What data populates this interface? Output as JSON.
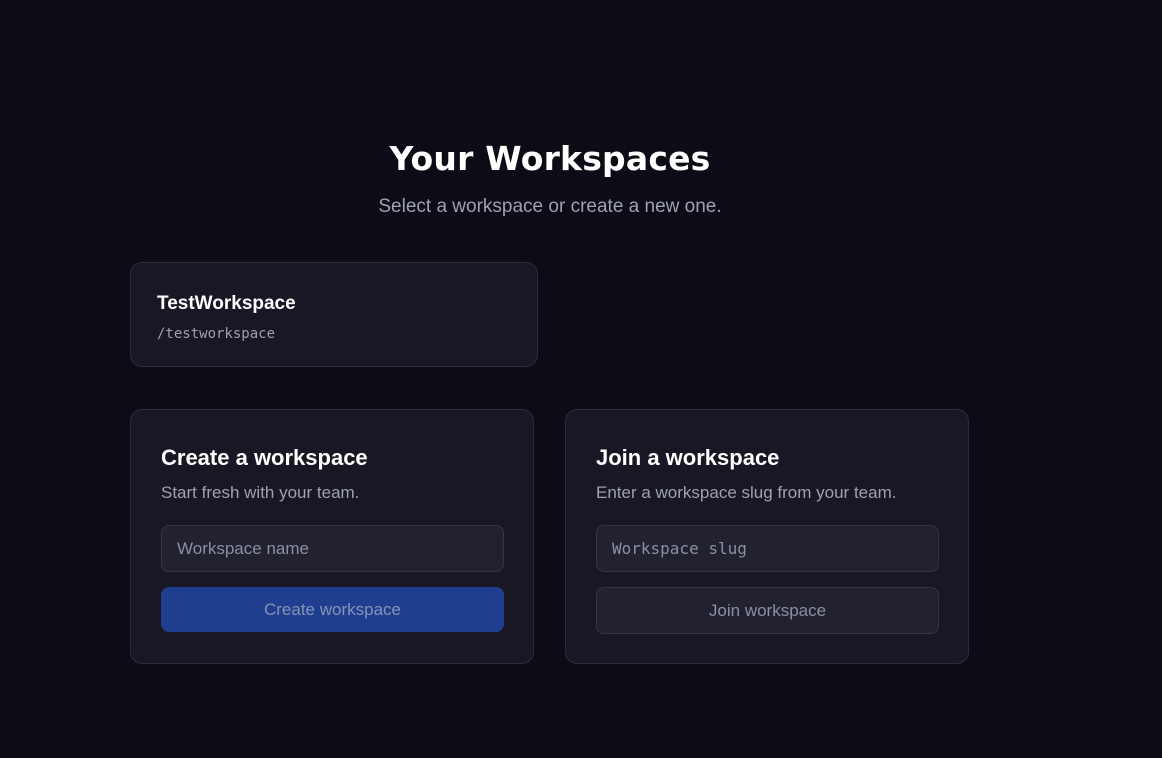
{
  "header": {
    "title": "Your Workspaces",
    "subtitle": "Select a workspace or create a new one."
  },
  "workspaces": [
    {
      "name": "TestWorkspace",
      "slug": "/testworkspace"
    }
  ],
  "create": {
    "title": "Create a workspace",
    "description": "Start fresh with your team.",
    "input_placeholder": "Workspace name",
    "input_value": "",
    "button_label": "Create workspace"
  },
  "join": {
    "title": "Join a workspace",
    "description": "Enter a workspace slug from your team.",
    "input_placeholder": "Workspace slug",
    "input_value": "",
    "button_label": "Join workspace"
  },
  "colors": {
    "background": "#0c0b16",
    "card": "#181723",
    "primary_button": "#1f3e8f",
    "muted_text": "#9ea1b3"
  }
}
